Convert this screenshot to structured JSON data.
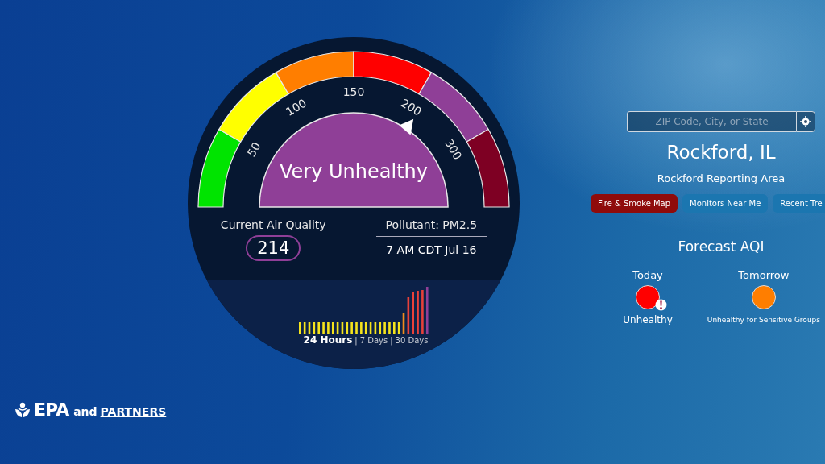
{
  "gauge": {
    "category": "Very Unhealthy",
    "color": "#8f3f97",
    "bands": [
      {
        "color": "#00e400",
        "tick": "50"
      },
      {
        "color": "#ffff00",
        "tick": "100"
      },
      {
        "color": "#ff7e00",
        "tick": "150"
      },
      {
        "color": "#ff0000",
        "tick": "200"
      },
      {
        "color": "#8f3f97",
        "tick": "300"
      },
      {
        "color": "#7e0023"
      }
    ]
  },
  "current": {
    "label": "Current Air Quality",
    "value": "214",
    "pollutant": "Pollutant: PM2.5",
    "time": "7 AM CDT Jul 16"
  },
  "history": {
    "tabs": [
      {
        "label": "24 Hours",
        "selected": true
      },
      {
        "label": "7 Days",
        "selected": false
      },
      {
        "label": "30 Days",
        "selected": false
      }
    ],
    "separators": [
      "|",
      "|"
    ]
  },
  "search": {
    "placeholder": "ZIP Code, City, or State"
  },
  "location": {
    "name": "Rockford, IL",
    "area": "Rockford Reporting Area"
  },
  "buttons": [
    {
      "label": "Fire & Smoke Map",
      "kind": "alert"
    },
    {
      "label": "Monitors Near Me",
      "kind": "normal"
    },
    {
      "label": "Recent Tre",
      "kind": "normal"
    }
  ],
  "forecast": {
    "title": "Forecast AQI",
    "days": [
      {
        "label": "Today",
        "color": "#ff0000",
        "category": "Unhealthy",
        "alert": true
      },
      {
        "label": "Tomorrow",
        "color": "#ff7e00",
        "category": "Unhealthy for Sensitive Groups",
        "alert": false
      }
    ]
  },
  "footer": {
    "logo": "EPA",
    "and": "and",
    "link": "PARTNERS"
  }
}
